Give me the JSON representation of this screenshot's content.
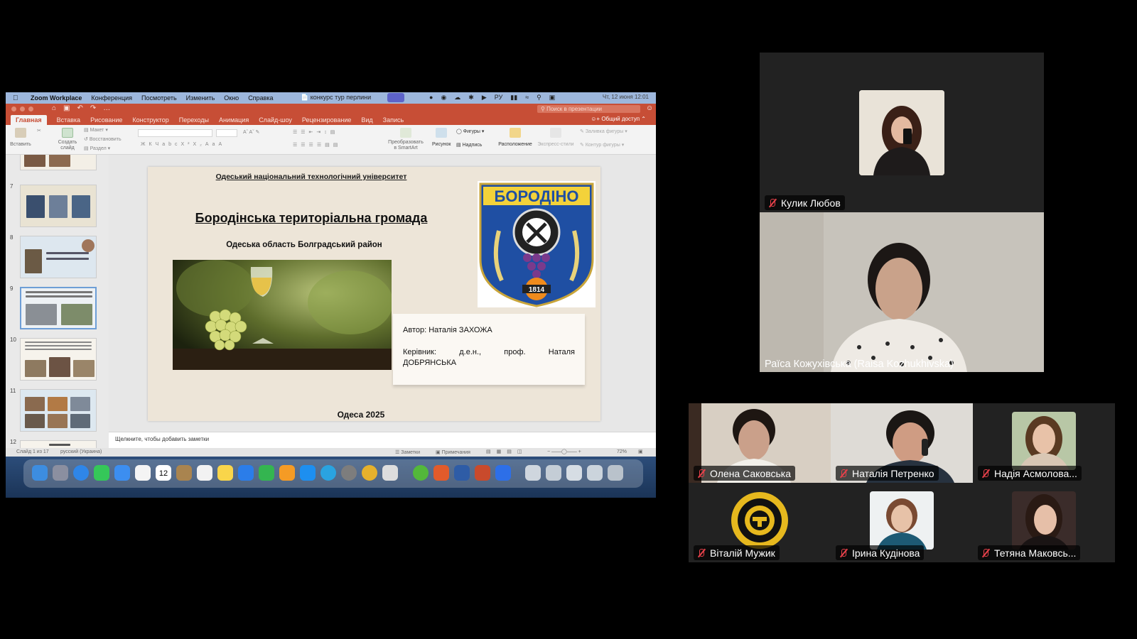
{
  "menubar": {
    "app": "Zoom Workplace",
    "items": [
      "Конференция",
      "Посмотреть",
      "Изменить",
      "Окно",
      "Справка"
    ],
    "doc_title": "конкурс тур перлини",
    "lang": "РУ",
    "clock": "Чт, 12 июня 12:01"
  },
  "ppt": {
    "search_placeholder": "Поиск в презентации",
    "share_label": "Общий доступ",
    "tabs": [
      "Главная",
      "Вставка",
      "Рисование",
      "Конструктор",
      "Переходы",
      "Анимация",
      "Слайд-шоу",
      "Рецензирование",
      "Вид",
      "Запись"
    ],
    "ribbon": {
      "paste": "Вставить",
      "new_slide": "Создать слайд",
      "layout": "Макет",
      "reset": "Восстановить",
      "section": "Раздел",
      "smartart": "Преобразовать в SmartArt",
      "picture": "Рисунок",
      "shapes": "Фигуры",
      "textbox": "Надпись",
      "arrange": "Расположение",
      "quick_styles": "Экспресс-стили",
      "shape_fill": "Заливка фигуры",
      "shape_outline": "Контур фигуры"
    },
    "thumbs": [
      "7",
      "8",
      "9",
      "10",
      "11",
      "12"
    ],
    "slide": {
      "university": "Одеський національний технологічний університет",
      "title": "Бородінська територіальна громада",
      "region": "Одеська область Болградський район",
      "coat_name": "БОРОДІНО",
      "coat_year": "1814",
      "author": "Автор: Наталія ЗАХОЖА",
      "supervisor_line1": "Керівник:      д.е.н.,      проф.      Наталя",
      "supervisor_line2": "ДОБРЯНСЬКА",
      "city_year": "Одеса 2025"
    },
    "notes_placeholder": "Щелкните, чтобы добавить заметки",
    "status": {
      "slide_of": "Слайд 1 из 17",
      "language": "русский (Украина)",
      "notes": "Заметки",
      "comments": "Примечания",
      "zoom": "72%"
    }
  },
  "participants": [
    {
      "name": "Кулик Любов",
      "muted": true
    },
    {
      "name": "Раїса Кожухівська (Raisa Kozhukhivska)",
      "muted": false
    },
    {
      "name": "Олена Саковська",
      "muted": true
    },
    {
      "name": "Наталія Петренко",
      "muted": true
    },
    {
      "name": "Надія Асмолова...",
      "muted": true
    },
    {
      "name": "Віталій Мужик",
      "muted": true
    },
    {
      "name": "Ірина  Кудінова",
      "muted": true
    },
    {
      "name": "Тетяна Маковсь...",
      "muted": true
    }
  ]
}
